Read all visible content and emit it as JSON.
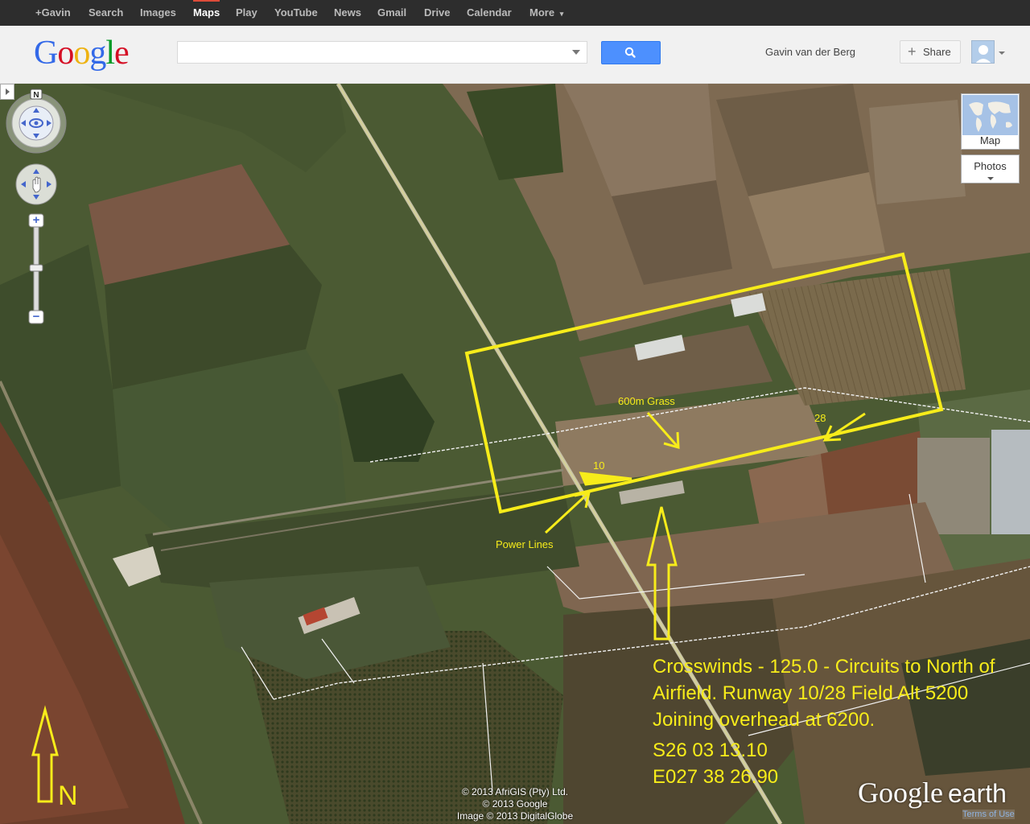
{
  "topbar": {
    "items": [
      {
        "label": "+Gavin"
      },
      {
        "label": "Search"
      },
      {
        "label": "Images"
      },
      {
        "label": "Maps",
        "active": true
      },
      {
        "label": "Play"
      },
      {
        "label": "YouTube"
      },
      {
        "label": "News"
      },
      {
        "label": "Gmail"
      },
      {
        "label": "Drive"
      },
      {
        "label": "Calendar"
      },
      {
        "label": "More"
      }
    ],
    "more_arrow": "▾"
  },
  "header": {
    "logo_letters": [
      {
        "ch": "G",
        "color": "#3369e8"
      },
      {
        "ch": "o",
        "color": "#d50f25"
      },
      {
        "ch": "o",
        "color": "#eeb211"
      },
      {
        "ch": "g",
        "color": "#3369e8"
      },
      {
        "ch": "l",
        "color": "#009925"
      },
      {
        "ch": "e",
        "color": "#d50f25"
      }
    ],
    "search": {
      "value": "",
      "placeholder": "",
      "icon": "search-icon"
    },
    "user_name": "Gavin van der Berg",
    "share_label": "Share",
    "share_icon": "plus-icon"
  },
  "map": {
    "annotations": {
      "grass": "600m Grass",
      "runway_28": "28",
      "runway_10": "10",
      "power_lines": "Power Lines",
      "north": "N",
      "info_lines": [
        "Crosswinds - 125.0 - Circuits to North of",
        "Airfield. Runway 10/28 Field Alt 5200",
        "Joining overhead at 6200.",
        "S26 03 13.10",
        "E027 38 26.90"
      ]
    },
    "compass_north": "N",
    "zoom_plus": "+",
    "zoom_minus": "−",
    "map_type_label": "Map",
    "photos_label": "Photos",
    "copyright": [
      "© 2013 AfriGIS (Pty) Ltd.",
      "© 2013 Google",
      "Image © 2013 DigitalGlobe"
    ],
    "logo_google": "Google",
    "logo_earth": "earth",
    "terms": "Terms of Use",
    "annotation_color": "#f7ec1a"
  }
}
